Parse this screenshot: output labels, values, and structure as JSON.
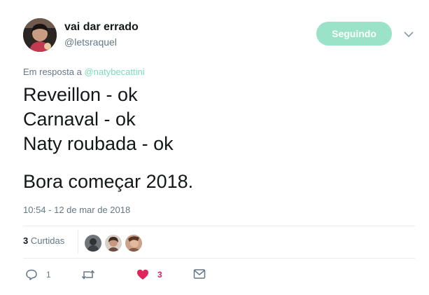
{
  "author": {
    "name": "vai dar errado",
    "handle": "@letsraquel",
    "avatar_icon": "profile-photo-icon"
  },
  "follow_button": {
    "label": "Seguindo",
    "color": "#9be3c8"
  },
  "reply": {
    "prefix": "Em resposta a",
    "mention": "@natybecattini",
    "mention_color": "#79dcb9"
  },
  "tweet": {
    "lines": [
      "Reveillon - ok",
      "Carnaval - ok",
      "Naty roubada - ok",
      "",
      "Bora começar 2018."
    ]
  },
  "timestamp": "10:54 - 12 de mar de 2018",
  "likes": {
    "count": "3",
    "label": "Curtidas"
  },
  "actions": {
    "reply_count": "1",
    "retweet_count": "",
    "like_count": "3",
    "like_color": "#e0245e"
  }
}
